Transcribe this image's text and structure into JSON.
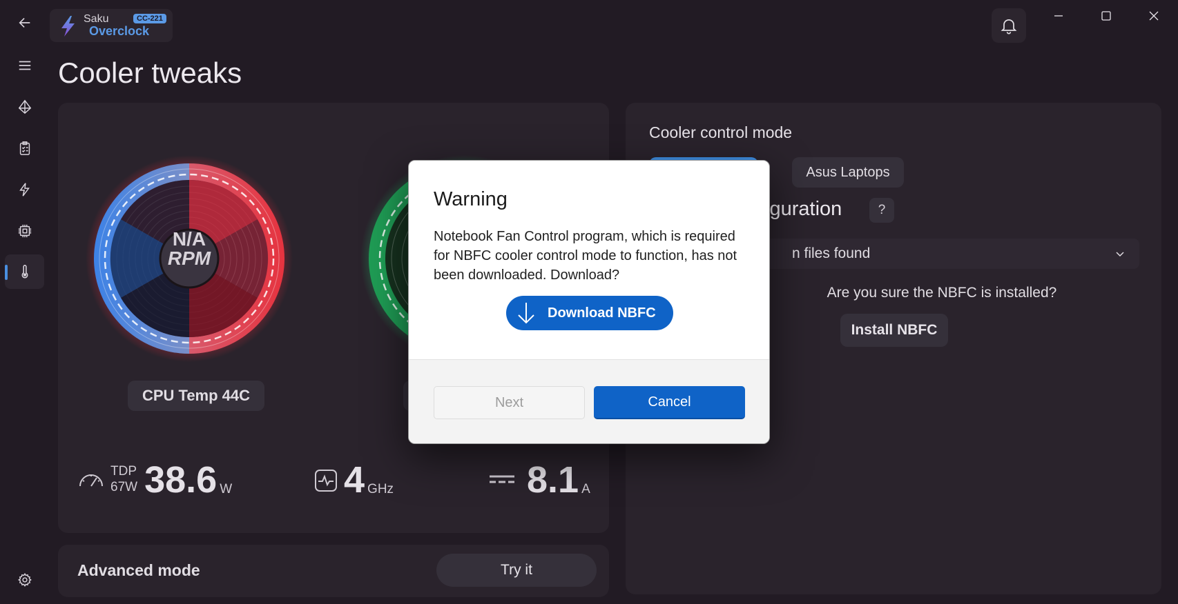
{
  "app": {
    "name": "Saku",
    "subtitle": "Overclock",
    "version": "CC-221"
  },
  "page": {
    "title": "Cooler tweaks"
  },
  "sidebar": {
    "items": [
      {
        "icon": "back-arrow-icon"
      },
      {
        "icon": "hamburger-menu-icon"
      },
      {
        "icon": "presets-icon"
      },
      {
        "icon": "checklist-icon"
      },
      {
        "icon": "power-bolt-icon"
      },
      {
        "icon": "cpu-chip-icon"
      },
      {
        "icon": "thermometer-icon",
        "active": true
      },
      {
        "icon": "settings-gear-icon"
      }
    ]
  },
  "left_card": {
    "cpu_fan": {
      "rpm_value": "N/A",
      "rpm_unit": "RPM"
    },
    "cpu_temp_label": "CPU Temp 44C",
    "stats": {
      "tdp_label": "TDP",
      "tdp_limit": "67W",
      "power_value": "38.6",
      "power_unit": "W",
      "freq_value": "4",
      "freq_unit": "GHz",
      "current_value": "8.1",
      "current_unit": "A"
    }
  },
  "advanced": {
    "label": "Advanced mode",
    "button": "Try it"
  },
  "right_card": {
    "title": "Cooler control mode",
    "mode_asus": "Asus Laptops",
    "config_title_visible": "figuration",
    "help_label": "?",
    "config_select_visible": "n files found",
    "nbfc_question": "Are you sure the NBFC is installed?",
    "install_button": "Install NBFC"
  },
  "dialog": {
    "title": "Warning",
    "body": "Notebook Fan Control program, which is required for NBFC cooler control mode to function, has not been downloaded. Download?",
    "download_button": "Download NBFC",
    "next_button": "Next",
    "cancel_button": "Cancel"
  },
  "colors": {
    "accent": "#0f63c7",
    "app_accent": "#5b9ae6",
    "background": "#221b24",
    "card": "#2a232c"
  }
}
